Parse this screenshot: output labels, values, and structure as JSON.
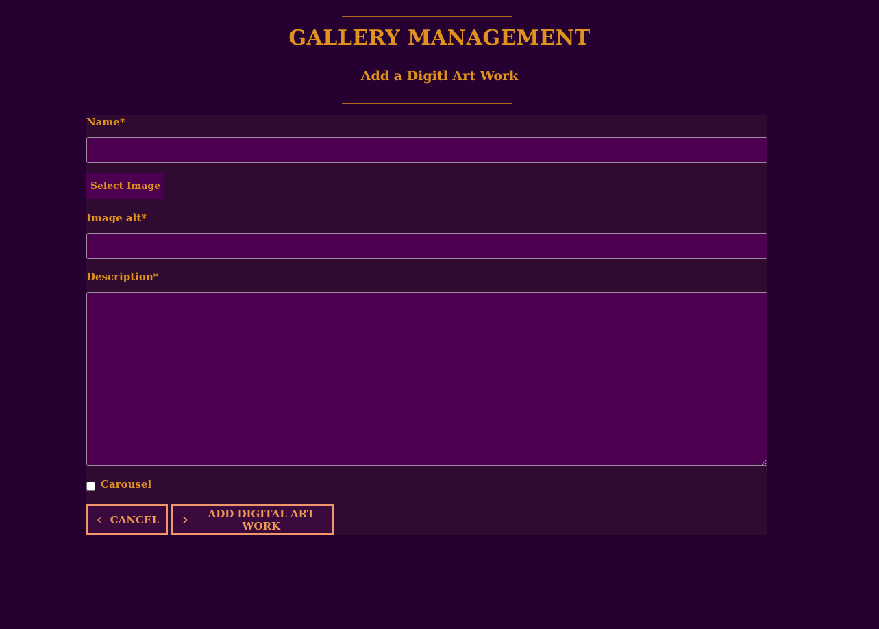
{
  "header": {
    "title": "GALLERY MANAGEMENT",
    "subtitle": "Add a Digitl Art Work"
  },
  "form": {
    "name_label": "Name*",
    "name_value": "",
    "select_image_label": "Select Image",
    "image_alt_label": "Image alt*",
    "image_alt_value": "",
    "description_label": "Description*",
    "description_value": "",
    "carousel_label": "Carousel",
    "carousel_checked": false
  },
  "actions": {
    "cancel_label": "CANCEL",
    "cancel_icon": "chevron-left-icon",
    "add_label": "ADD DIGITAL ART WORK",
    "add_icon": "chevron-right-icon"
  },
  "colors": {
    "background": "#260030",
    "panel": "#2f0b32",
    "input_fill": "#4d0050",
    "accent_gold": "#e0921e",
    "button_border": "#f0956c"
  }
}
